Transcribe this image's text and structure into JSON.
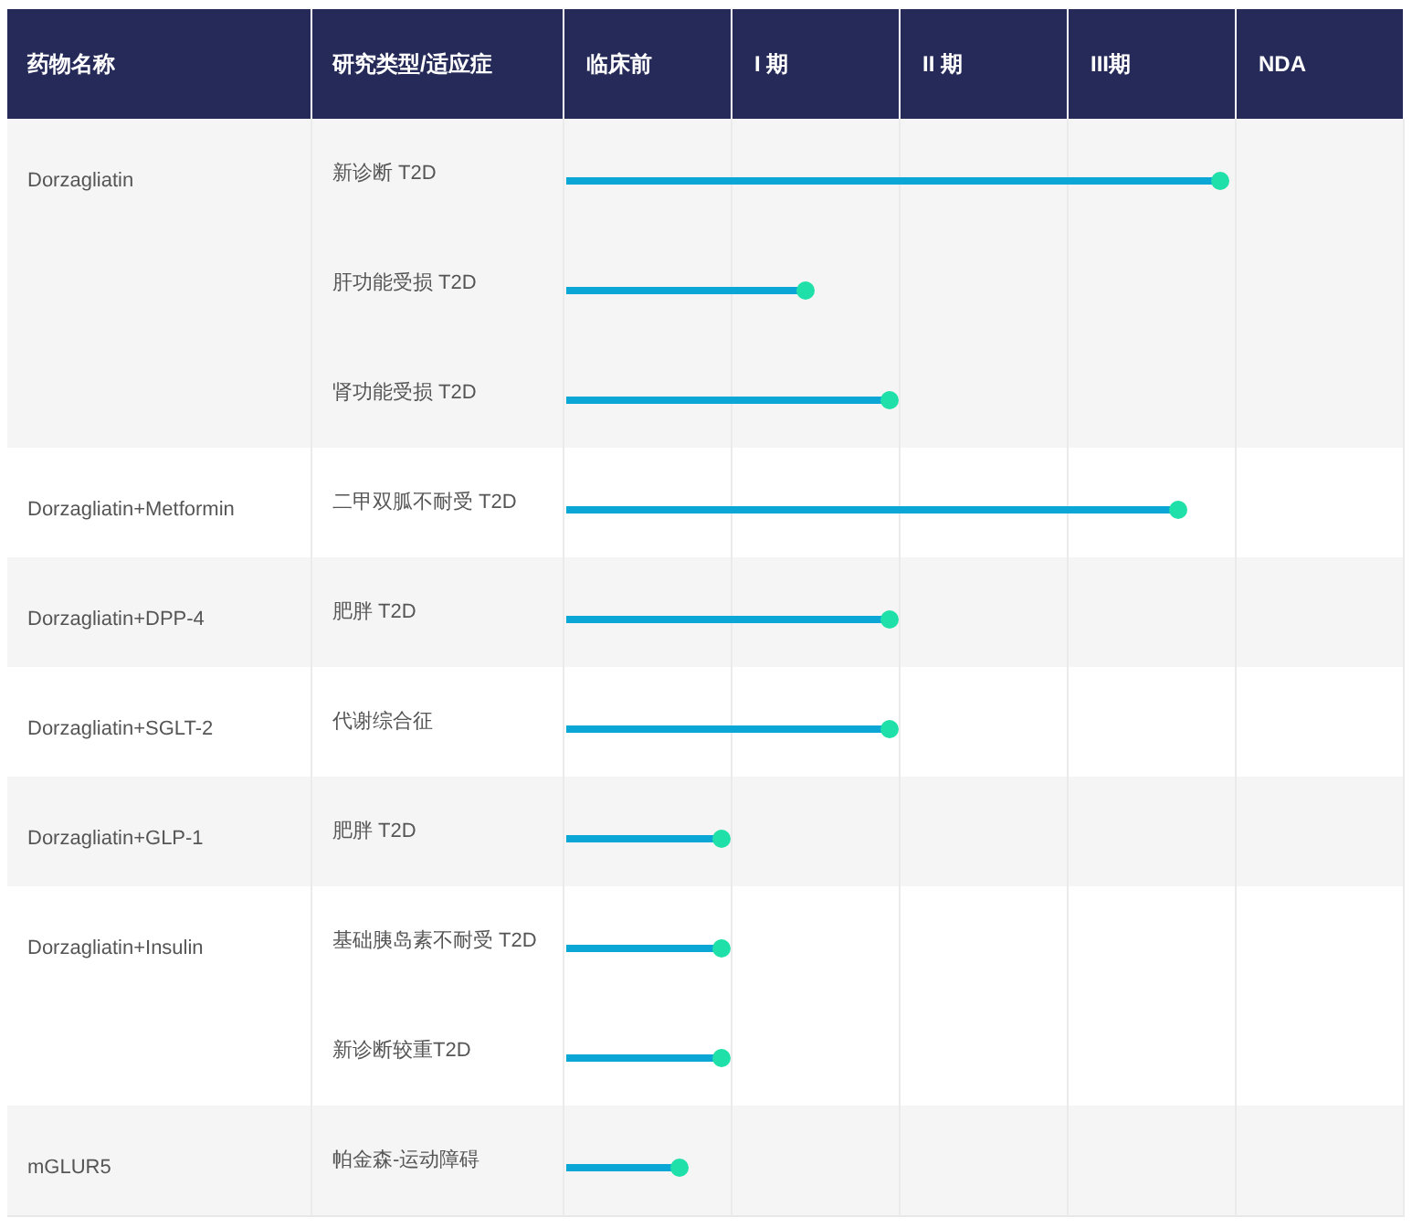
{
  "columns": [
    "药物名称",
    "研究类型/适应症",
    "临床前",
    "I 期",
    "II 期",
    "III期",
    "NDA"
  ],
  "drugs": [
    {
      "name": "Dorzagliatin",
      "studies": [
        {
          "indication": "新诊断 T2D",
          "level": 0.78
        },
        {
          "indication": "肝功能受损 T2D",
          "level": 0.285
        },
        {
          "indication": "肾功能受损 T2D",
          "level": 0.385
        }
      ]
    },
    {
      "name": "Dorzagliatin+Metformin",
      "studies": [
        {
          "indication": "二甲双胍不耐受 T2D",
          "level": 0.73
        }
      ]
    },
    {
      "name": "Dorzagliatin+DPP-4",
      "studies": [
        {
          "indication": "肥胖 T2D",
          "level": 0.385
        }
      ]
    },
    {
      "name": "Dorzagliatin+SGLT-2",
      "studies": [
        {
          "indication": "代谢综合征",
          "level": 0.385
        }
      ]
    },
    {
      "name": "Dorzagliatin+GLP-1",
      "studies": [
        {
          "indication": "肥胖 T2D",
          "level": 0.185
        }
      ]
    },
    {
      "name": "Dorzagliatin+Insulin",
      "studies": [
        {
          "indication": "基础胰岛素不耐受 T2D",
          "level": 0.185
        },
        {
          "indication": "新诊断较重T2D",
          "level": 0.185
        }
      ]
    },
    {
      "name": "mGLUR5",
      "studies": [
        {
          "indication": "帕金森-运动障碍",
          "level": 0.135
        }
      ]
    }
  ]
}
